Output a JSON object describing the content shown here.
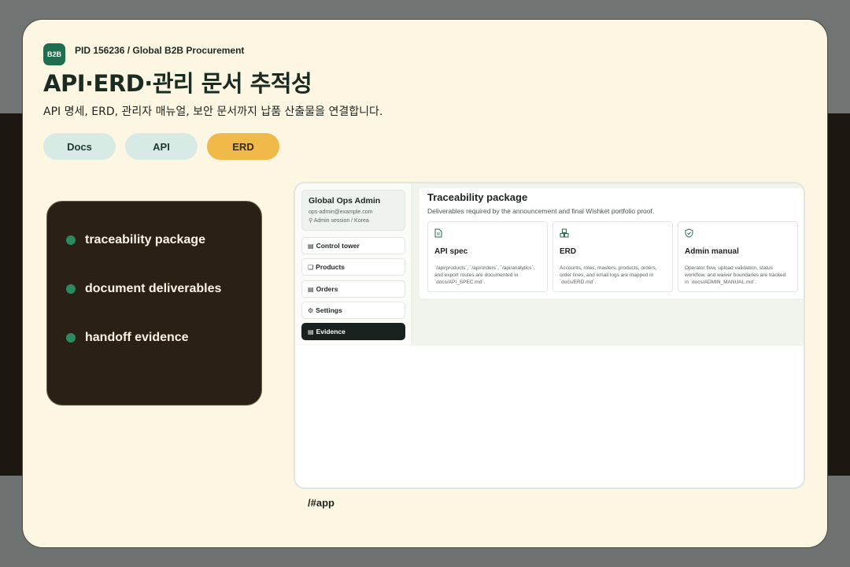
{
  "header": {
    "badge": "B2B",
    "pid": "PID 156236 / Global B2B Procurement",
    "title": "API·ERD·관리 문서 추적성",
    "subtitle": "API 명세, ERD, 관리자 매뉴얼, 보안 문서까지 납품 산출물을 연결합니다."
  },
  "tabs": [
    {
      "label": "Docs",
      "active": false
    },
    {
      "label": "API",
      "active": false
    },
    {
      "label": "ERD",
      "active": true
    }
  ],
  "highlights": [
    "traceability package",
    "document deliverables",
    "handoff evidence"
  ],
  "app": {
    "profile": {
      "name": "Global Ops Admin",
      "email": "ops-admin@example.com",
      "session": "Admin session / Korea"
    },
    "nav": [
      {
        "label": "Control tower",
        "icon": "chart-icon",
        "active": false
      },
      {
        "label": "Products",
        "icon": "cubes-icon",
        "active": false
      },
      {
        "label": "Orders",
        "icon": "clipboard-icon",
        "active": false
      },
      {
        "label": "Settings",
        "icon": "users-gear-icon",
        "active": false
      },
      {
        "label": "Evidence",
        "icon": "document-icon",
        "active": true
      }
    ],
    "panel": {
      "title": "Traceability package",
      "subtitle": "Deliverables required by the announcement and final Wishket portfolio proof.",
      "cards": [
        {
          "icon": "document-icon",
          "title": "API spec",
          "desc": "`/api/products`, `/api/orders`, `/api/analytics`, and export routes are documented in `docs/API_SPEC.md`."
        },
        {
          "icon": "cubes-icon",
          "title": "ERD",
          "desc": "Accounts, roles, masters, products, orders, order lines, and email logs are mapped in `docs/ERD.md`."
        },
        {
          "icon": "shield-icon",
          "title": "Admin manual",
          "desc": "Operator flow, upload validation, status workflow, and waiver boundaries are tracked in `docs/ADMIN_MANUAL.md`."
        }
      ]
    }
  },
  "route": "/#app",
  "colors": {
    "accent": "#1f6e4f",
    "active_tab": "#f0b94a",
    "dark_panel": "#2b2016"
  }
}
